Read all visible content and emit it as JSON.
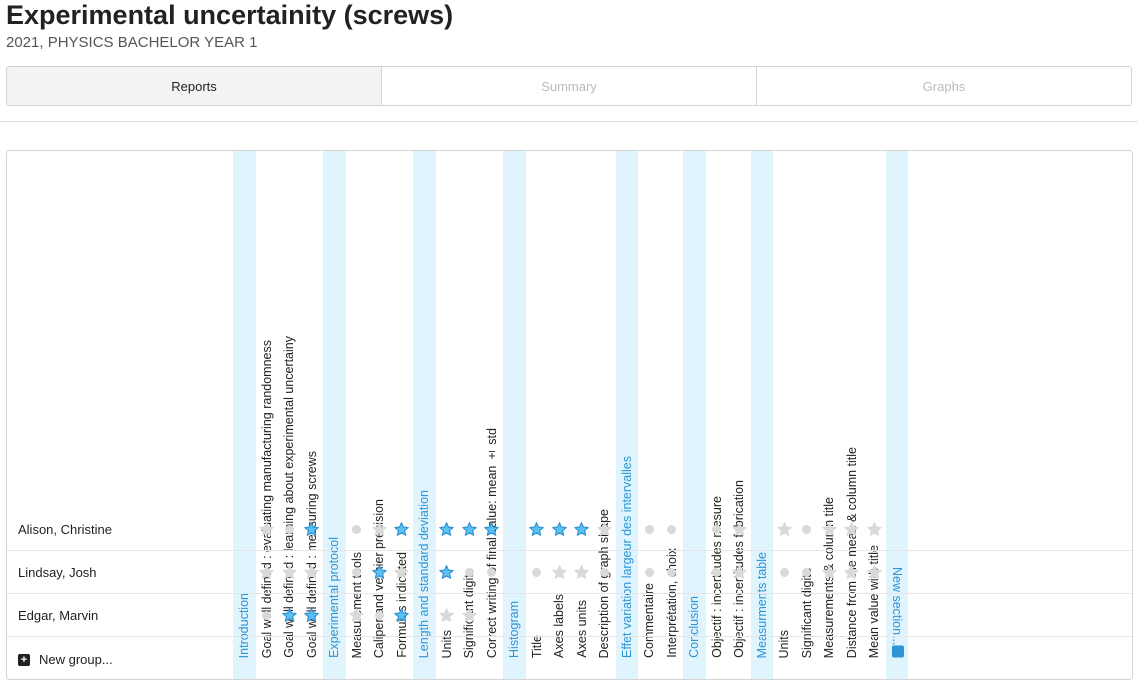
{
  "header": {
    "title": "Experimental uncertainity (screws)",
    "subtitle": "2021, PHYSICS BACHELOR YEAR 1"
  },
  "tabs": [
    {
      "label": "Reports",
      "active": true
    },
    {
      "label": "Summary",
      "active": false
    },
    {
      "label": "Graphs",
      "active": false
    }
  ],
  "columns": [
    {
      "label": "Introduction",
      "section": true
    },
    {
      "label": "Goal well defined : evaluating manufacturing randomness",
      "section": false
    },
    {
      "label": "Goal well defined : learning about experimental uncertainy",
      "section": false
    },
    {
      "label": "Goal well defined : measuring screws",
      "section": false
    },
    {
      "label": "Experimental protocol",
      "section": true
    },
    {
      "label": "Measurement tools",
      "section": false
    },
    {
      "label": "Caliper and vernier precision",
      "section": false
    },
    {
      "label": "Formulas indicated",
      "section": false
    },
    {
      "label": "Length and standard deviation",
      "section": true
    },
    {
      "label": "Units",
      "section": false
    },
    {
      "label": "Significant digits",
      "section": false
    },
    {
      "label": "Correct writing of final value: mean ± std",
      "section": false
    },
    {
      "label": "Histogram",
      "section": true
    },
    {
      "label": "Title",
      "section": false
    },
    {
      "label": "Axes labels",
      "section": false
    },
    {
      "label": "Axes units",
      "section": false
    },
    {
      "label": "Description of graph shape",
      "section": false
    },
    {
      "label": "Effet variation largeur des intervalles",
      "section": true
    },
    {
      "label": "Commentaire",
      "section": false
    },
    {
      "label": "Interprétation, choix",
      "section": false
    },
    {
      "label": "Conclusion",
      "section": true
    },
    {
      "label": "Objectif : incertitudes mesure",
      "section": false
    },
    {
      "label": "Objectif : incertitudes fabrication",
      "section": false
    },
    {
      "label": "Measurments table",
      "section": true
    },
    {
      "label": "Units",
      "section": false
    },
    {
      "label": "Significant digits",
      "section": false
    },
    {
      "label": "Measurements & column title",
      "section": false
    },
    {
      "label": "Distance from the mean & column title",
      "section": false
    },
    {
      "label": "Mean value with title",
      "section": false
    }
  ],
  "new_section_label": "New section...",
  "students": [
    {
      "name": "Alison, Christine",
      "cells": [
        "",
        "star-gray",
        "dot",
        "star-blue",
        "",
        "dot",
        "star-gray",
        "star-blue",
        "",
        "star-blue",
        "star-blue",
        "star-blue",
        "",
        "star-blue",
        "star-blue",
        "star-blue",
        "star-gray",
        "",
        "dot",
        "dot",
        "",
        "dot",
        "star-gray",
        "",
        "star-gray",
        "dot",
        "star-gray",
        "star-gray",
        "star-gray"
      ]
    },
    {
      "name": "Lindsay, Josh",
      "cells": [
        "",
        "star-gray",
        "star-gray",
        "star-gray",
        "",
        "dot",
        "star-blue",
        "star-gray",
        "",
        "star-blue",
        "dot",
        "dot",
        "",
        "dot",
        "star-gray",
        "star-gray",
        "dot",
        "",
        "dot",
        "dot",
        "",
        "dot",
        "star-gray",
        "",
        "dot",
        "dot",
        "star-gray",
        "star-gray",
        "star-gray"
      ]
    },
    {
      "name": "Edgar, Marvin",
      "cells": [
        "",
        "dot",
        "star-blue",
        "star-blue",
        "",
        "star-gray",
        "dot",
        "star-blue",
        "",
        "star-gray",
        "star-gray",
        "",
        "",
        "",
        "",
        "",
        "",
        "",
        "",
        "",
        "",
        "",
        "",
        "",
        "",
        "",
        "",
        "",
        ""
      ]
    }
  ],
  "new_group_label": "New group...",
  "colors": {
    "accent": "#2b95d6",
    "section_bg": "#dff4fd",
    "star_blue": "#5bc0f2",
    "star_gray": "#d9d9d9"
  },
  "icons": {
    "rated": "star-icon",
    "unrated": "star-outline-icon",
    "empty": "dot-icon",
    "add": "plus-icon"
  }
}
